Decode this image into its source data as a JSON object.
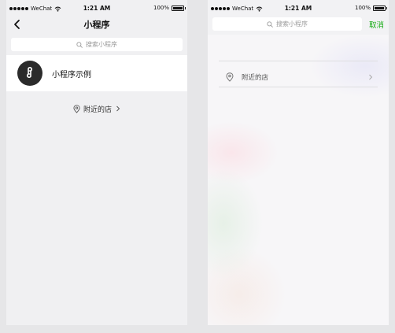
{
  "status_bar": {
    "carrier": "WeChat",
    "time": "1:21 AM",
    "battery": "100%"
  },
  "left_screen": {
    "title": "小程序",
    "search_placeholder": "搜索小程序",
    "mini_program_name": "小程序示例",
    "nearby_label": "附近的店"
  },
  "right_screen": {
    "search_placeholder": "搜索小程序",
    "cancel_label": "取消",
    "nearby_label": "附近的店"
  },
  "colors": {
    "accent_green": "#1aad19",
    "logo_background": "#2b2b2b"
  },
  "icons": {
    "back": "chevron-left-icon",
    "search": "search-icon",
    "location": "location-pin-icon",
    "chevron": "chevron-right-icon",
    "wifi": "wifi-icon",
    "battery": "battery-icon",
    "mini_program_logo": "mini-program-logo-icon"
  }
}
